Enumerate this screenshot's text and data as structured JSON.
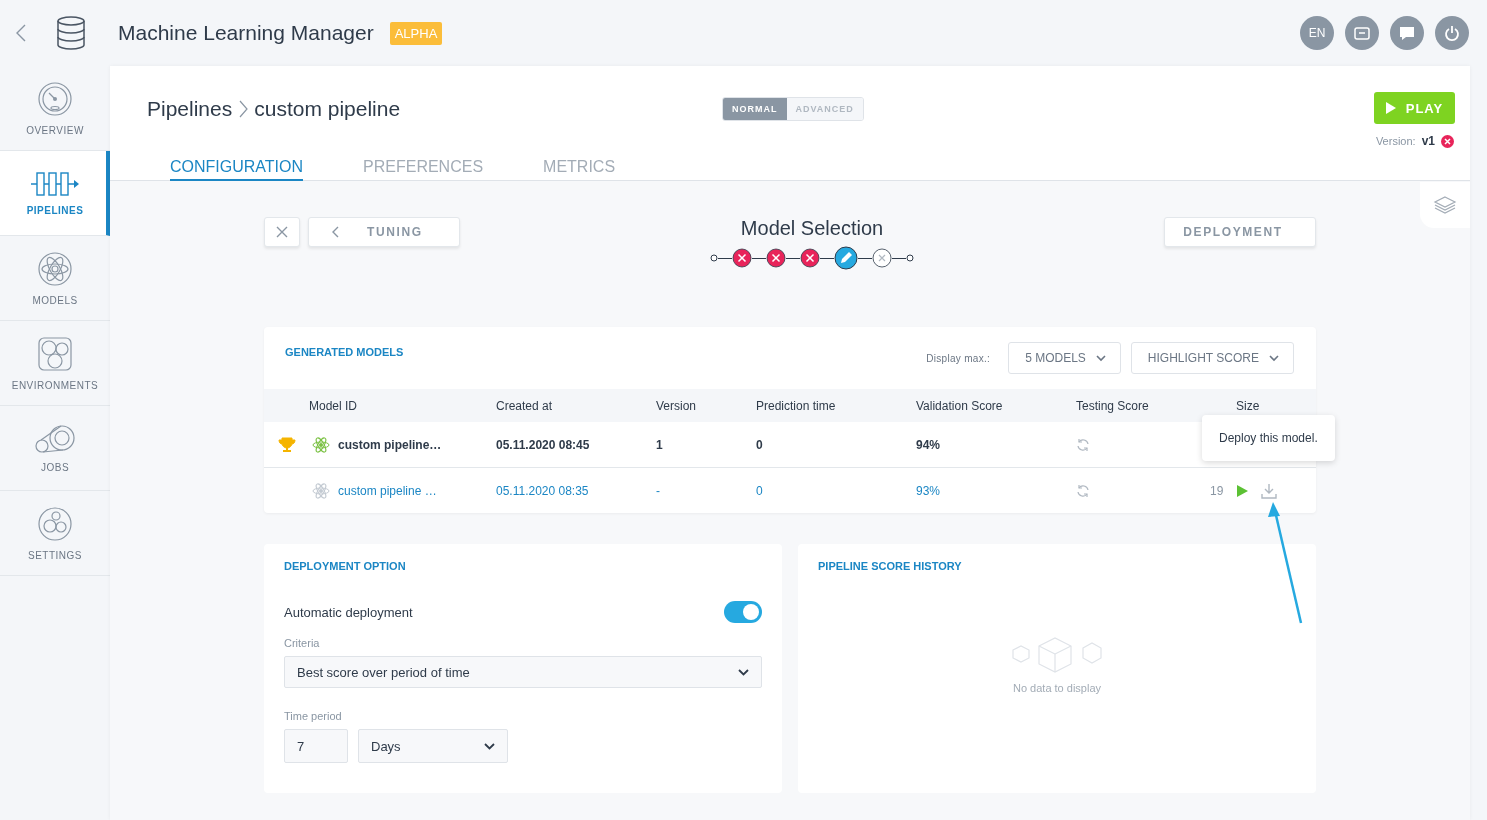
{
  "header": {
    "title": "Machine Learning Manager",
    "badge": "ALPHA",
    "language": "EN"
  },
  "sidebar": {
    "items": [
      {
        "label": "OVERVIEW",
        "selected": false
      },
      {
        "label": "PIPELINES",
        "selected": true
      },
      {
        "label": "MODELS",
        "selected": false
      },
      {
        "label": "ENVIRONMENTS",
        "selected": false
      },
      {
        "label": "JOBS",
        "selected": false
      },
      {
        "label": "SETTINGS",
        "selected": false
      }
    ]
  },
  "breadcrumb": [
    "Pipelines",
    "custom pipeline"
  ],
  "mode_toggle": [
    {
      "label": "NORMAL",
      "selected": true
    },
    {
      "label": "ADVANCED",
      "selected": false
    }
  ],
  "play_button": "PLAY",
  "version_label": "Version:",
  "version": "v1",
  "tabs": [
    {
      "label": "CONFIGURATION",
      "selected": true
    },
    {
      "label": "PREFERENCES",
      "selected": false
    },
    {
      "label": "METRICS",
      "selected": false
    }
  ],
  "stepper": {
    "back": "TUNING",
    "next": "DEPLOYMENT",
    "title": "Model Selection",
    "steps": [
      {
        "kind": "error"
      },
      {
        "kind": "error"
      },
      {
        "kind": "error"
      },
      {
        "kind": "current"
      },
      {
        "kind": "pending"
      }
    ]
  },
  "generated_models": {
    "title": "GENERATED MODELS",
    "display_max_label": "Display max.:",
    "display_max": "5 MODELS",
    "highlight": "HIGHLIGHT SCORE",
    "columns": [
      "Model ID",
      "Created at",
      "Version",
      "Prediction time",
      "Validation Score",
      "Testing Score",
      "Size"
    ],
    "rows": [
      {
        "best": true,
        "model_id": "custom pipeline…",
        "created_at": "05.11.2020 08:45",
        "version": "1",
        "prediction_time": "0",
        "validation_score": "94%"
      },
      {
        "best": false,
        "model_id": "custom pipeline …",
        "created_at": "05.11.2020 08:35",
        "version": "-",
        "prediction_time": "0",
        "validation_score": "93%",
        "size": "19"
      }
    ],
    "tooltip": "Deploy this model."
  },
  "deployment_option": {
    "title": "DEPLOYMENT OPTION",
    "auto_label": "Automatic deployment",
    "auto_on": true,
    "criteria_label": "Criteria",
    "criteria": "Best score over period of time",
    "period_label": "Time period",
    "period_value": "7",
    "period_unit": "Days"
  },
  "score_history": {
    "title": "PIPELINE SCORE HISTORY",
    "empty": "No data to display"
  }
}
